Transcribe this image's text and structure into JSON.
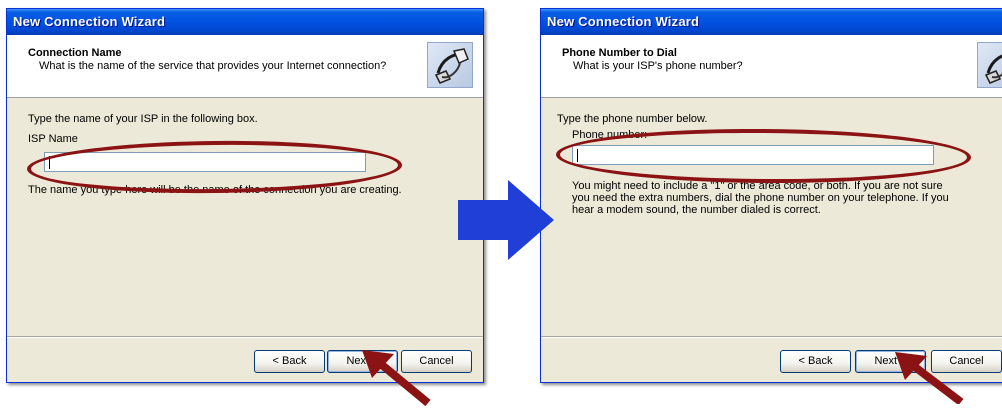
{
  "wizard1": {
    "title": "New Connection Wizard",
    "header_title": "Connection Name",
    "header_subtitle": "What is the name of the service that provides your Internet connection?",
    "instruction": "Type the name of your ISP in the following box.",
    "field_label": "ISP Name",
    "field_value": "",
    "hint": "The name you type here will be the name of the connection you are creating.",
    "buttons": {
      "back": "< Back",
      "next": "Next >",
      "cancel": "Cancel"
    },
    "icon": "phone-connector-icon"
  },
  "wizard2": {
    "title": "New Connection Wizard",
    "header_title": "Phone Number to Dial",
    "header_subtitle": "What is your ISP's phone number?",
    "instruction": "Type the phone number below.",
    "field_label": "Phone number:",
    "field_value": "",
    "hint_lines": [
      "You might need to include a \"1\" or the area code, or both. If you are not sure",
      "you need the extra numbers, dial the phone number on your telephone. If you",
      "hear a modem sound, the number dialed is correct."
    ],
    "buttons": {
      "back": "< Back",
      "next": "Next >",
      "cancel": "Cancel"
    },
    "icon": "phone-connector-icon"
  },
  "annotations": {
    "highlight_color": "#8b1313",
    "pointer_arrow_color": "#8b1313",
    "flow_arrow_color": "#1f3fd6"
  }
}
